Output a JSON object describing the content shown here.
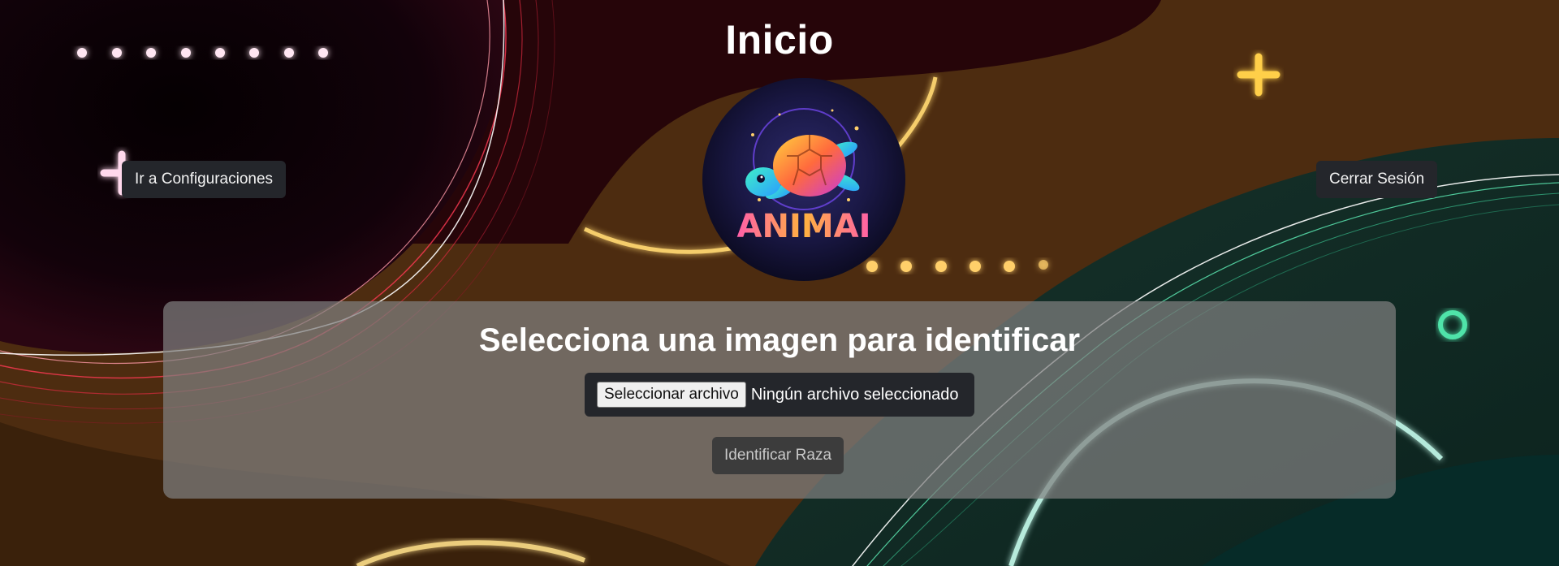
{
  "header": {
    "title": "Inicio"
  },
  "logo": {
    "text": "ANIMAI",
    "icon": "turtle-logo-icon"
  },
  "nav": {
    "config_button_label": "Ir a Configuraciones",
    "logout_button_label": "Cerrar Sesión"
  },
  "upload_card": {
    "heading": "Selecciona una imagen para identificar",
    "file_button_label": "Seleccionar archivo",
    "file_status": "Ningún archivo seleccionado",
    "identify_button_label": "Identificar Raza"
  },
  "theme": {
    "button_dark": "#24262b",
    "card_overlay": "#808080",
    "accent_yellow": "#ffc93c",
    "accent_green": "#4fe3a9",
    "accent_red": "#e0314b"
  }
}
